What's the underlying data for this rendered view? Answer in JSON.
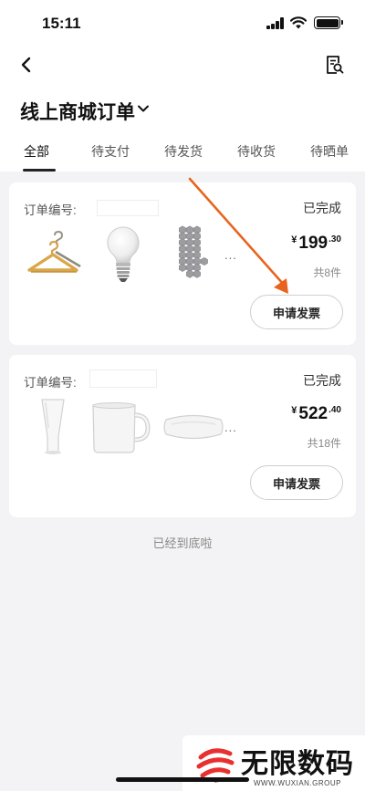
{
  "status_bar": {
    "time": "15:11"
  },
  "header": {
    "title": "线上商城订单"
  },
  "tabs": [
    {
      "label": "全部",
      "active": true
    },
    {
      "label": "待支付",
      "active": false
    },
    {
      "label": "待发货",
      "active": false
    },
    {
      "label": "待收货",
      "active": false
    },
    {
      "label": "待晒单",
      "active": false
    }
  ],
  "orders": [
    {
      "order_label": "订单编号:",
      "status": "已完成",
      "items": [
        "hanger-product",
        "light-bulb-product",
        "hexagon-tiles-product"
      ],
      "more": "...",
      "currency": "¥",
      "price_int": "199",
      "price_dec": ".30",
      "count": "共8件",
      "action_label": "申请发票"
    },
    {
      "order_label": "订单编号:",
      "status": "已完成",
      "items": [
        "glass-product",
        "mug-product",
        "pillow-product"
      ],
      "more": "...",
      "currency": "¥",
      "price_int": "522",
      "price_dec": ".40",
      "count": "共18件",
      "action_label": "申请发票"
    }
  ],
  "footer": {
    "end_text": "已经到底啦"
  },
  "watermark": {
    "name": "无限数码",
    "site": "WWW.WUXIAN.GROUP"
  },
  "colors": {
    "annotation_arrow": "#e8641e",
    "tab_indicator": "#222222",
    "page_background": "#f3f3f5"
  }
}
